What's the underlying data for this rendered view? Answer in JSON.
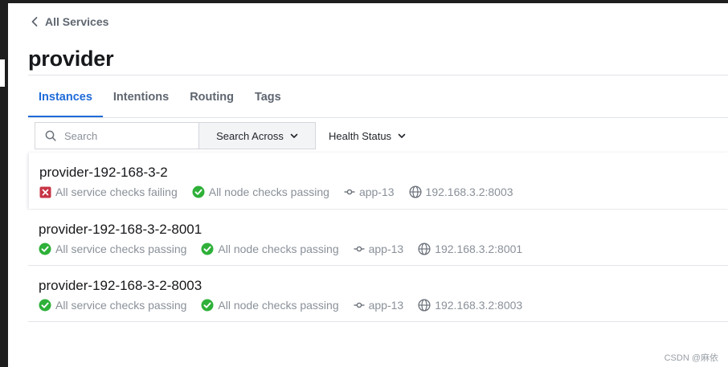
{
  "breadcrumb": {
    "label": "All Services"
  },
  "page": {
    "title": "provider"
  },
  "tabs": [
    {
      "label": "Instances",
      "active": true
    },
    {
      "label": "Intentions",
      "active": false
    },
    {
      "label": "Routing",
      "active": false
    },
    {
      "label": "Tags",
      "active": false
    }
  ],
  "filters": {
    "search_placeholder": "Search",
    "search_value": "",
    "search_across_label": "Search Across",
    "health_status_label": "Health Status"
  },
  "instances": [
    {
      "name": "provider-192-168-3-2",
      "service_checks": "All service checks failing",
      "service_status": "failing",
      "node_checks": "All node checks passing",
      "node_status": "passing",
      "node": "app-13",
      "address": "192.168.3.2:8003"
    },
    {
      "name": "provider-192-168-3-2-8001",
      "service_checks": "All service checks passing",
      "service_status": "passing",
      "node_checks": "All node checks passing",
      "node_status": "passing",
      "node": "app-13",
      "address": "192.168.3.2:8001"
    },
    {
      "name": "provider-192-168-3-2-8003",
      "service_checks": "All service checks passing",
      "service_status": "passing",
      "node_checks": "All node checks passing",
      "node_status": "passing",
      "node": "app-13",
      "address": "192.168.3.2:8003"
    }
  ],
  "watermark": "CSDN @麻依",
  "colors": {
    "accent": "#1f6bd8",
    "passing": "#2eb039",
    "failing": "#c73445"
  }
}
